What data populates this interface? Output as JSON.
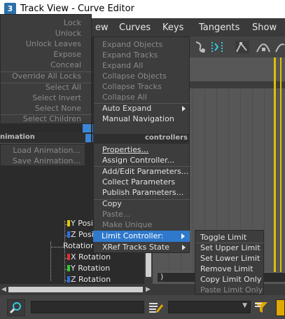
{
  "window": {
    "app_icon": "3",
    "title": "Track View - Curve Editor"
  },
  "menubar": {
    "partial_item": "ew",
    "items": [
      "Curves",
      "Keys",
      "Tangents",
      "Show"
    ]
  },
  "lock_menu": {
    "items": [
      {
        "label": "Lock",
        "enabled": false
      },
      {
        "label": "Unlock",
        "enabled": false
      },
      {
        "label": "Unlock Leaves",
        "enabled": false
      },
      {
        "label": "Expose",
        "enabled": false
      },
      {
        "label": "Conceal",
        "enabled": false
      },
      {
        "label": "Override All Locks",
        "enabled": false
      },
      {
        "label": "Select All",
        "enabled": false
      },
      {
        "label": "Select Invert",
        "enabled": false
      },
      {
        "label": "Select None",
        "enabled": false
      },
      {
        "label": "Select Children",
        "enabled": false
      }
    ]
  },
  "animation_section": {
    "header": "nimation",
    "items": [
      {
        "label": "Load Animation...",
        "enabled": false
      },
      {
        "label": "Save Animation...",
        "enabled": false
      }
    ]
  },
  "context_menu": {
    "section_header": "controllers",
    "items": [
      {
        "label": "Expand Objects",
        "enabled": false
      },
      {
        "label": "Expand Tracks",
        "enabled": false
      },
      {
        "label": "Expand All",
        "enabled": false
      },
      {
        "label": "Collapse Objects",
        "enabled": false
      },
      {
        "label": "Collapse Tracks",
        "enabled": false
      },
      {
        "label": "Collapse All",
        "enabled": false
      },
      {
        "label": "Auto Expand",
        "enabled": true,
        "submenu": true
      },
      {
        "label": "Manual Navigation",
        "enabled": true
      },
      {
        "label": "Properties...",
        "enabled": true
      },
      {
        "label": "Assign Controller...",
        "enabled": true
      },
      {
        "label": "Add/Edit Parameters...",
        "enabled": true
      },
      {
        "label": "Collect Parameters",
        "enabled": true
      },
      {
        "label": "Publish Parameters...",
        "enabled": true
      },
      {
        "label": "Copy",
        "enabled": true
      },
      {
        "label": "Paste...",
        "enabled": false
      },
      {
        "label": "Make Unique",
        "enabled": false
      },
      {
        "label": "Limit Controller:",
        "enabled": true,
        "submenu": true,
        "highlighted": true
      },
      {
        "label": "XRef Tracks State",
        "enabled": true,
        "submenu": true
      }
    ]
  },
  "limit_submenu": {
    "items": [
      {
        "label": "Toggle Limit",
        "enabled": true
      },
      {
        "label": "Set Upper Limit",
        "enabled": true
      },
      {
        "label": "Set Lower Limit",
        "enabled": true
      },
      {
        "label": "Remove Limit",
        "enabled": true
      },
      {
        "label": "Copy Limit Only",
        "enabled": true
      },
      {
        "label": "Paste Limit Only",
        "enabled": false
      }
    ]
  },
  "tree": {
    "rows": [
      {
        "label": "Y Posit",
        "color": "#e6c800"
      },
      {
        "label": "Z Posit",
        "color": "#2f6fe0"
      },
      {
        "label": "Rotation",
        "color": ""
      },
      {
        "label": "X Rotation",
        "color": "#e03030"
      },
      {
        "label": "Y Rotation",
        "color": "#33cc33"
      },
      {
        "label": "Z Rotation",
        "color": "#2f6fe0"
      }
    ]
  },
  "graph": {
    "frame_label": ")"
  },
  "colors": {
    "highlight": "#2f79cc",
    "curve": "#e0c000"
  }
}
